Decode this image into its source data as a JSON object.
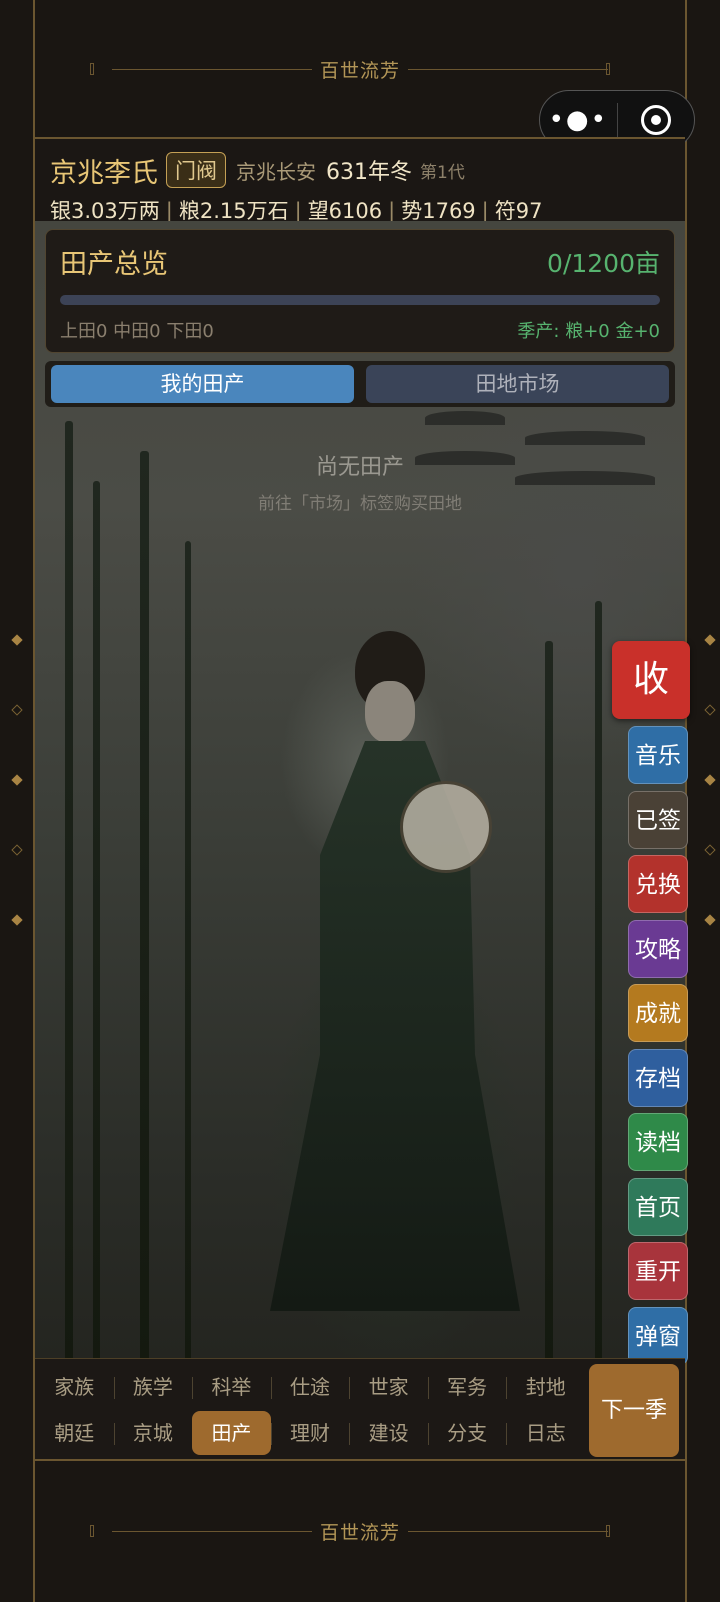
{
  "game_title": "百世流芳",
  "capsule": {
    "more_icon": "more-dots-icon",
    "close_icon": "target-icon"
  },
  "header": {
    "clan": "京兆李氏",
    "rank": "门阀",
    "place": "京兆长安",
    "year": "631年冬",
    "generation": "第1代",
    "resources": {
      "silver": "银3.03万两",
      "grain": "粮2.15万石",
      "prestige": "望6106",
      "power": "势1769",
      "talisman": "符97"
    }
  },
  "overview": {
    "title": "田产总览",
    "acreage": "0/1200亩",
    "fill_ratio": 0,
    "grades": "上田0 中田0 下田0",
    "season_yield": "季产: 粮+0 金+0"
  },
  "tabs": {
    "my_land": "我的田产",
    "market": "田地市场"
  },
  "empty": {
    "title": "尚无田产",
    "hint": "前往「市场」标签购买田地"
  },
  "side_menu": {
    "collect": "收",
    "buttons": [
      {
        "label": "音乐",
        "color": "#2f6ea6"
      },
      {
        "label": "已签",
        "color": "#4a4136"
      },
      {
        "label": "兑换",
        "color": "#b3322c"
      },
      {
        "label": "攻略",
        "color": "#6a3a93"
      },
      {
        "label": "成就",
        "color": "#b47a1f"
      },
      {
        "label": "存档",
        "color": "#2f5f9e"
      },
      {
        "label": "读档",
        "color": "#2f8a49"
      },
      {
        "label": "首页",
        "color": "#2f7a5b"
      },
      {
        "label": "重开",
        "color": "#a8343c"
      },
      {
        "label": "弹窗",
        "color": "#2f6ea6"
      }
    ]
  },
  "nav": {
    "row1": [
      "家族",
      "族学",
      "科举",
      "仕途",
      "世家",
      "军务",
      "封地"
    ],
    "row2": [
      "朝廷",
      "京城",
      "田产",
      "理财",
      "建设",
      "分支",
      "日志"
    ],
    "active": "田产",
    "next_season": "下一季"
  }
}
